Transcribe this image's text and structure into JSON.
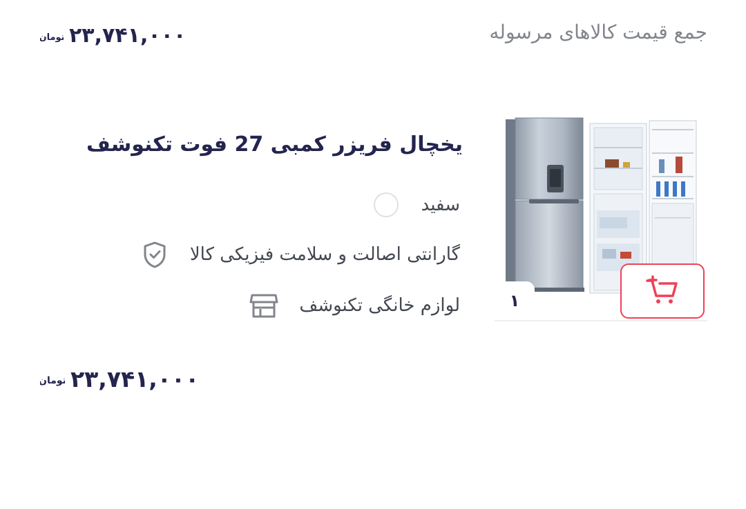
{
  "summary": {
    "label": "جمع قیمت کالاهای مرسوله",
    "price": "۲۳,۷۴۱,۰۰۰",
    "currency": "تومان"
  },
  "product": {
    "title": "یخچال فریزر کمبی 27 فوت تکنوشف",
    "quantity": "۱",
    "attributes": {
      "color": "سفید",
      "warranty": "گارانتی اصالت و سلامت فیزیکی کالا",
      "seller": "لوازم خانگی تکنوشف"
    },
    "image_icon": "fridge-freezer-image",
    "cart_icon": "cart-add-icon",
    "accent_color": "#ef4056"
  },
  "total": {
    "price": "۲۳,۷۴۱,۰۰۰",
    "currency": "تومان"
  }
}
